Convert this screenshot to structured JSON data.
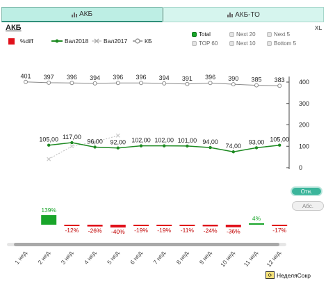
{
  "tabs": [
    {
      "label": "АКБ",
      "active": true,
      "icon": "bar-chart-icon"
    },
    {
      "label": "АКБ-ТО",
      "active": false,
      "icon": "bar-chart-icon"
    }
  ],
  "title": "АКБ",
  "xl_label": "XL",
  "legend": {
    "diff": "%diff",
    "val2018": "Вал2018",
    "val2017": "Вал2017",
    "kb": "КБ"
  },
  "filters": [
    {
      "label": "Total",
      "selected": true
    },
    {
      "label": "Next 20",
      "selected": false
    },
    {
      "label": "Next 5",
      "selected": false
    },
    {
      "label": "TOP 60",
      "selected": false
    },
    {
      "label": "Next 10",
      "selected": false
    },
    {
      "label": "Bottom 5",
      "selected": false
    }
  ],
  "buttons": {
    "otn": "Отн.",
    "abs": "Абс."
  },
  "dimension_label": "НеделяСокр",
  "colors": {
    "tab_active": "#bdeee4",
    "val2018": "#1e8a22",
    "kb": "#888888",
    "val2017": "#c8c8c8",
    "diff_negative": "#e0101a",
    "diff_positive": "#19a52a"
  },
  "chart_data": {
    "type": "line",
    "categories": [
      "1 нед.",
      "2 нед.",
      "3 нед.",
      "4 нед.",
      "5 нед.",
      "6 нед.",
      "7 нед.",
      "8 нед.",
      "9 нед.",
      "10 нед.",
      "11 нед.",
      "12 нед."
    ],
    "yticks": [
      "0",
      "100",
      "200",
      "300",
      "400"
    ],
    "ylim": [
      0,
      400
    ],
    "series": [
      {
        "name": "КБ",
        "values": [
          401,
          397,
          396,
          394,
          396,
          396,
          394,
          391,
          396,
          390,
          385,
          383
        ],
        "labels": [
          "401",
          "397",
          "396",
          "394",
          "396",
          "396",
          "394",
          "391",
          "396",
          "390",
          "385",
          "383"
        ]
      },
      {
        "name": "Вал2018",
        "values": [
          null,
          105,
          117,
          96,
          92,
          102,
          102,
          101,
          94,
          74,
          93,
          105
        ],
        "labels": [
          null,
          "105,00",
          "117,00",
          "96,00",
          "92,00",
          "102,00",
          "102,00",
          "101,00",
          "94,00",
          "74,00",
          "93,00",
          "105,00"
        ]
      },
      {
        "name": "Вал2017",
        "values": [
          null,
          40,
          100,
          120,
          150,
          null,
          null,
          null,
          null,
          null,
          null,
          null
        ]
      }
    ],
    "diff": {
      "name": "%diff",
      "values": [
        null,
        139,
        -12,
        -26,
        -40,
        -19,
        -19,
        -11,
        -24,
        -36,
        4,
        -17
      ],
      "labels": [
        null,
        "139%",
        "-12%",
        "-26%",
        "-40%",
        "-19%",
        "-19%",
        "-11%",
        "-24%",
        "-36%",
        "4%",
        "-17%"
      ]
    },
    "legend_position": "top-left",
    "grid": false
  }
}
